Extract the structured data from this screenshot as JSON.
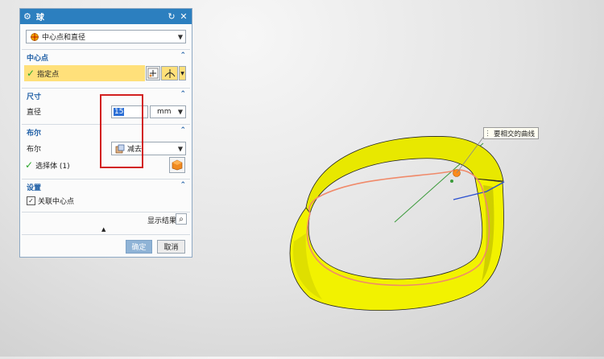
{
  "dialog": {
    "title": "球",
    "type_select": {
      "value": "中心点和直径"
    },
    "center_section": {
      "title": "中心点",
      "specify_point_label": "指定点"
    },
    "size_section": {
      "title": "尺寸",
      "diameter_label": "直径",
      "diameter_value": "15",
      "unit": "mm"
    },
    "boolean_section": {
      "title": "布尔",
      "boolean_label": "布尔",
      "boolean_value": "减去",
      "select_body_label": "选择体 (1)"
    },
    "settings_section": {
      "title": "设置",
      "associative_center_label": "关联中心点",
      "associative_center_checked": true
    },
    "show_result_label": "显示结果",
    "ok_label": "确定",
    "cancel_label": "取消"
  },
  "viewport": {
    "tooltip_text": "要相交的曲线"
  },
  "colors": {
    "title_bar": "#2c7fbf",
    "highlight_row": "#ffe07a",
    "red_annotation": "#d22020",
    "ring_fill": "#f2f200"
  }
}
